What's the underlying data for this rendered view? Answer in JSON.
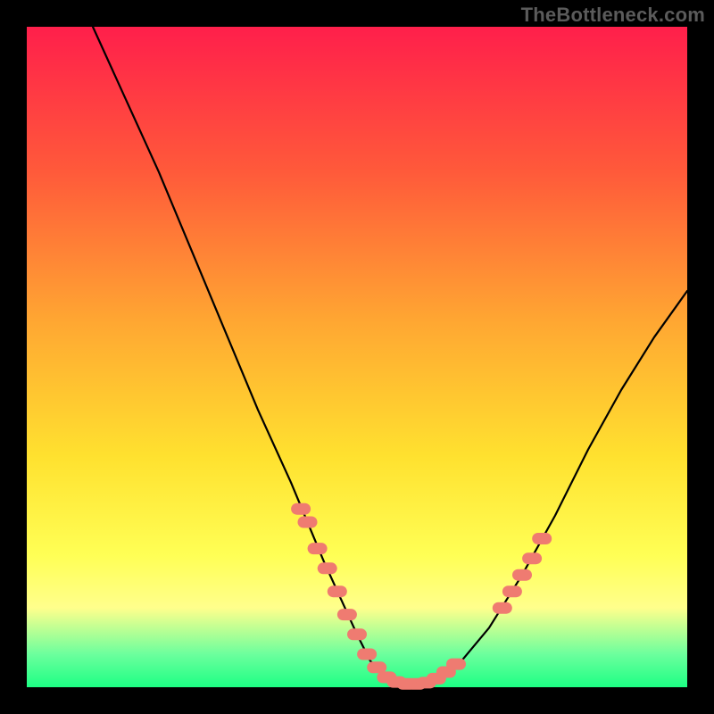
{
  "watermark": "TheBottleneck.com",
  "colors": {
    "background": "#000000",
    "marker": "#ef7b71",
    "curve": "#000000",
    "gradient_stops": [
      "#ff1f4b",
      "#ff5a3a",
      "#ffa832",
      "#ffe12f",
      "#ffff55",
      "#ffff8c",
      "#6cff9d",
      "#1dff84"
    ]
  },
  "chart_data": {
    "type": "line",
    "title": "",
    "xlabel": "",
    "ylabel": "",
    "xlim": [
      0,
      100
    ],
    "ylim": [
      0,
      100
    ],
    "grid": false,
    "axes_visible": false,
    "curve": {
      "x": [
        10,
        15,
        20,
        25,
        30,
        35,
        40,
        45,
        50,
        52,
        55,
        57,
        60,
        62,
        65,
        70,
        75,
        80,
        85,
        90,
        95,
        100
      ],
      "y": [
        100,
        89,
        78,
        66,
        54,
        42,
        31,
        19,
        8,
        4,
        1,
        0.5,
        0.5,
        1,
        3,
        9,
        17,
        26,
        36,
        45,
        53,
        60
      ]
    },
    "markers": [
      {
        "x": 41.5,
        "y": 27
      },
      {
        "x": 42.5,
        "y": 25
      },
      {
        "x": 44,
        "y": 21
      },
      {
        "x": 45.5,
        "y": 18
      },
      {
        "x": 47,
        "y": 14.5
      },
      {
        "x": 48.5,
        "y": 11
      },
      {
        "x": 50,
        "y": 8
      },
      {
        "x": 51.5,
        "y": 5
      },
      {
        "x": 53,
        "y": 3
      },
      {
        "x": 54.5,
        "y": 1.5
      },
      {
        "x": 56,
        "y": 0.8
      },
      {
        "x": 57.5,
        "y": 0.5
      },
      {
        "x": 59,
        "y": 0.5
      },
      {
        "x": 60.5,
        "y": 0.7
      },
      {
        "x": 62,
        "y": 1.3
      },
      {
        "x": 63.5,
        "y": 2.3
      },
      {
        "x": 65,
        "y": 3.5
      },
      {
        "x": 72,
        "y": 12
      },
      {
        "x": 73.5,
        "y": 14.5
      },
      {
        "x": 75,
        "y": 17
      },
      {
        "x": 76.5,
        "y": 19.5
      },
      {
        "x": 78,
        "y": 22.5
      }
    ]
  }
}
